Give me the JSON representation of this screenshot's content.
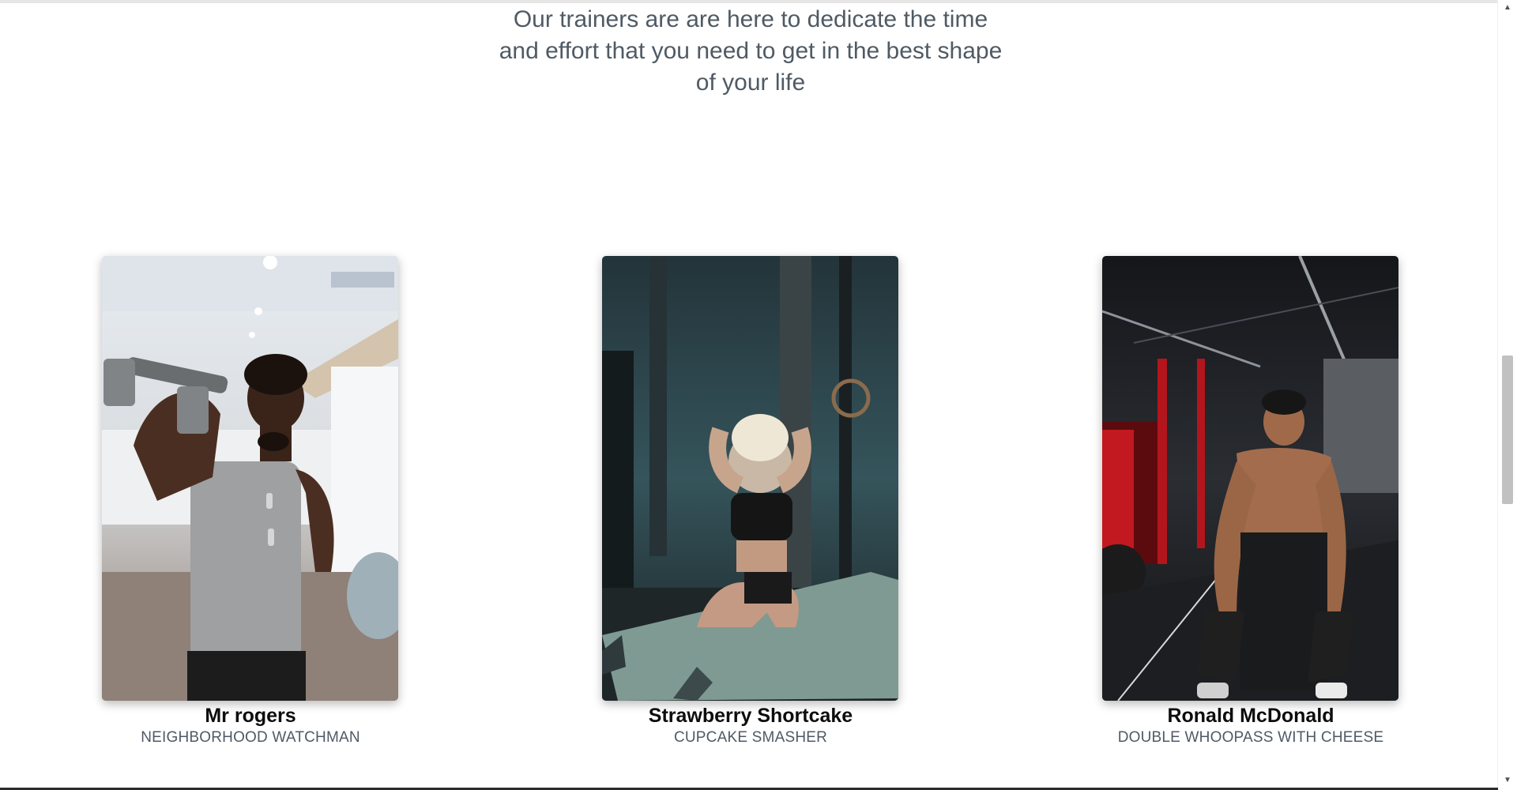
{
  "intro": {
    "text": "Our trainers are are here to dedicate the time and effort that you need to get in the best shape of your life"
  },
  "trainers": [
    {
      "name": "Mr rogers",
      "role": "NEIGHBORHOOD WATCHMAN"
    },
    {
      "name": "Strawberry Shortcake",
      "role": "CUPCAKE SMASHER"
    },
    {
      "name": "Ronald McDonald",
      "role": "DOUBLE WHOOPASS WITH CHEESE"
    }
  ],
  "scrollbar": {
    "up_icon": "triangle-up-icon",
    "down_icon": "triangle-down-icon"
  }
}
